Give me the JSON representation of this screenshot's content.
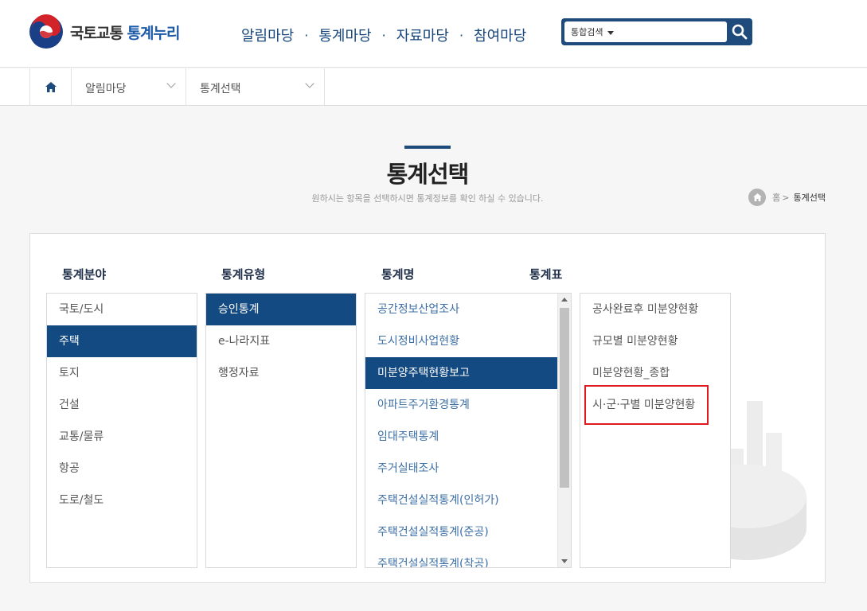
{
  "header": {
    "logo_text_1": "국토교통",
    "logo_text_2": "통계누리",
    "nav": [
      "알림마당",
      "통계마당",
      "자료마당",
      "참여마당"
    ],
    "nav_separator": "·",
    "search": {
      "scope_label": "통합검색"
    }
  },
  "location": {
    "dropdowns": [
      "알림마당",
      "통계선택"
    ]
  },
  "page": {
    "title": "통계선택",
    "description": "원하시는 항목을 선택하시면 통계정보를 확인 하실 수 있습니다.",
    "breadcrumb": {
      "home": "홈",
      "separator": ">",
      "current": "통계선택"
    }
  },
  "columns": {
    "field": {
      "header": "통계분야",
      "items": [
        "국토/도시",
        "주택",
        "토지",
        "건설",
        "교통/물류",
        "항공",
        "도로/철도"
      ],
      "selected": "주택"
    },
    "type": {
      "header": "통계유형",
      "items": [
        "승인통계",
        "e-나라지표",
        "행정자료"
      ],
      "selected": "승인통계"
    },
    "name": {
      "header": "통계명",
      "items": [
        "공간정보산업조사",
        "도시정비사업현황",
        "미분양주택현황보고",
        "아파트주거환경통계",
        "임대주택통계",
        "주거실태조사",
        "주택건설실적통계(인허가)",
        "주택건설실적통계(준공)",
        "주택건설실적통계(착공)"
      ],
      "selected": "미분양주택현황보고"
    },
    "table": {
      "header": "통계표",
      "items": [
        "공사완료후 미분양현황",
        "규모별 미분양현황",
        "미분양현황_종합",
        "시·군·구별 미분양현황"
      ],
      "highlighted": "시·군·구별 미분양현황"
    }
  },
  "colors": {
    "primary": "#144a82",
    "nav_text": "#16467c",
    "highlight_border": "#e0191f"
  }
}
